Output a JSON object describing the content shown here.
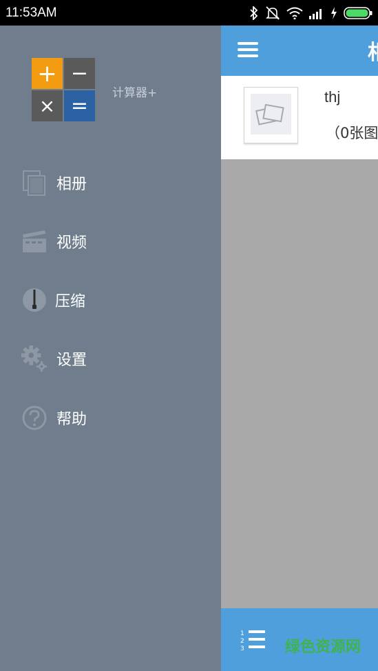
{
  "status_bar": {
    "time": "11:53AM"
  },
  "main": {
    "title": "相",
    "album": {
      "name": "thj",
      "count": "（0张图"
    },
    "watermark": "绿色资源网"
  },
  "drawer": {
    "app_name": "计算器+",
    "logo": {
      "plus": "+",
      "minus": "−",
      "times": "×",
      "equals": "="
    },
    "items": [
      {
        "label": "相册",
        "icon": "album-icon"
      },
      {
        "label": "视频",
        "icon": "video-icon"
      },
      {
        "label": "压缩",
        "icon": "zip-icon"
      },
      {
        "label": "设置",
        "icon": "settings-icon"
      },
      {
        "label": "帮助",
        "icon": "help-icon"
      }
    ]
  },
  "colors": {
    "drawer_bg": "#6f7d8c",
    "accent_blue": "#4f9fdc",
    "logo_orange": "#f39c12",
    "logo_gray": "#5a5a5a",
    "logo_blue": "#2a62a4",
    "battery_green": "#4cd964"
  }
}
